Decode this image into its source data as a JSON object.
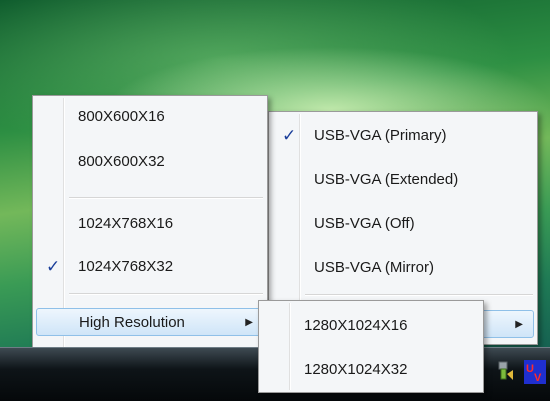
{
  "resolution_menu": {
    "items": [
      {
        "label": "800X600X16",
        "checked": false
      },
      {
        "label": "800X600X32",
        "checked": false
      },
      {
        "label": "1024X768X16",
        "checked": false
      },
      {
        "label": "1024X768X32",
        "checked": true
      }
    ],
    "high_resolution_label": "High Resolution"
  },
  "mode_menu": {
    "items": [
      {
        "label": "USB-VGA (Primary)",
        "checked": true
      },
      {
        "label": "USB-VGA (Extended)",
        "checked": false
      },
      {
        "label": "USB-VGA (Off)",
        "checked": false
      },
      {
        "label": "USB-VGA (Mirror)",
        "checked": false
      }
    ]
  },
  "high_resolution_submenu": {
    "items": [
      {
        "label": "1280X1024X16"
      },
      {
        "label": "1280X1024X32"
      }
    ]
  },
  "glyphs": {
    "checkmark": "✓",
    "submenu_arrow": "▶"
  },
  "colors": {
    "highlight": "#cfe5f8",
    "check": "#1b3f9a",
    "menu_bg": "#f4f6f8"
  },
  "tray": {
    "icons": [
      "usb-display-tray-icon",
      "uv-tray-icon"
    ]
  }
}
